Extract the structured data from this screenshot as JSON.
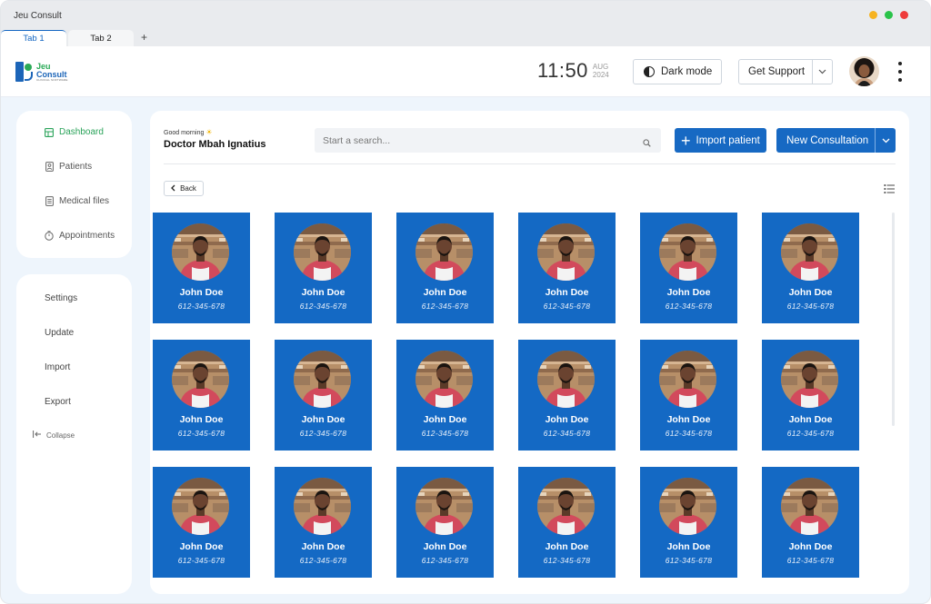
{
  "window": {
    "title": "Jeu Consult",
    "controls": {
      "colors": [
        "#f6b321",
        "#2ac34a",
        "#ee3b3b"
      ]
    }
  },
  "tabs": [
    {
      "label": "Tab 1",
      "active": true
    },
    {
      "label": "Tab 2",
      "active": false
    }
  ],
  "tab_add": "+",
  "header": {
    "logo": {
      "line1": "Jeu",
      "line2": "Consult",
      "tagline": "CLINICAL SOFTWARE"
    },
    "time": "11:50",
    "date_month": "AUG",
    "date_year": "2024",
    "dark_mode_label": "Dark mode",
    "support_label": "Get Support",
    "avatar_icon": "user-avatar",
    "menu_icon": "kebab-menu-icon"
  },
  "sidebar": {
    "nav": [
      {
        "label": "Dashboard",
        "icon": "dashboard-icon",
        "active": true
      },
      {
        "label": "Patients",
        "icon": "patients-icon",
        "active": false
      },
      {
        "label": "Medical files",
        "icon": "medical-files-icon",
        "active": false
      },
      {
        "label": "Appointments",
        "icon": "clock-icon",
        "active": false
      }
    ],
    "actions": [
      {
        "label": "Settings"
      },
      {
        "label": "Update"
      },
      {
        "label": "Import"
      },
      {
        "label": "Export"
      }
    ],
    "collapse_label": "Collapse"
  },
  "main": {
    "greeting": "Good morning",
    "doctor_name": "Doctor Mbah Ignatius",
    "search_placeholder": "Start a search...",
    "import_label": "Import patient",
    "new_consultation_label": "New Consultation",
    "back_label": "Back",
    "accent": "#1469c4",
    "patients": [
      {
        "name": "John Doe",
        "phone": "612-345-678"
      },
      {
        "name": "John Doe",
        "phone": "612-345-678"
      },
      {
        "name": "John Doe",
        "phone": "612-345-678"
      },
      {
        "name": "John Doe",
        "phone": "612-345-678"
      },
      {
        "name": "John Doe",
        "phone": "612-345-678"
      },
      {
        "name": "John Doe",
        "phone": "612-345-678"
      },
      {
        "name": "John Doe",
        "phone": "612-345-678"
      },
      {
        "name": "John Doe",
        "phone": "612-345-678"
      },
      {
        "name": "John Doe",
        "phone": "612-345-678"
      },
      {
        "name": "John Doe",
        "phone": "612-345-678"
      },
      {
        "name": "John Doe",
        "phone": "612-345-678"
      },
      {
        "name": "John Doe",
        "phone": "612-345-678"
      },
      {
        "name": "John Doe",
        "phone": "612-345-678"
      },
      {
        "name": "John Doe",
        "phone": "612-345-678"
      },
      {
        "name": "John Doe",
        "phone": "612-345-678"
      },
      {
        "name": "John Doe",
        "phone": "612-345-678"
      },
      {
        "name": "John Doe",
        "phone": "612-345-678"
      },
      {
        "name": "John Doe",
        "phone": "612-345-678"
      }
    ]
  }
}
